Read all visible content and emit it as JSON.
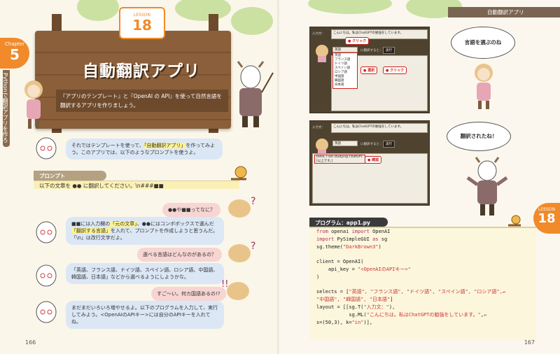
{
  "left": {
    "chapter": {
      "label": "Chapter",
      "number": "5"
    },
    "vertical_title": "Pythonで翻訳アプリを作ろう",
    "lesson": {
      "label": "LESSON",
      "number": "18"
    },
    "title": "自動翻訳アプリ",
    "subtitle": "『アプリのテンプレート』と『OpenAI の API』を使って自然言語を翻訳するアプリを作りましょう。",
    "bubble1": {
      "pre": "それではテンプレートを使って、",
      "highlight": "「自動翻訳アプリ」",
      "post": "を作ってみよう。このアプリでは、以下のようなプロンプトを使うよ。"
    },
    "prompt_label": "プロンプト",
    "prompt_text": "以下の文章を ●● に翻訳してください。\\n###■■",
    "bubble2": "●●や■■ってなに？",
    "bubble3": {
      "p1": "■■には入力欄の",
      "h1": "「元の文章」",
      "p2": "、●●にはコンボボックスで選んだ",
      "h2": "「翻訳する言語」",
      "p3": "を入れて、プロンプトを作成しようと思うんだ。「\\n」は改行文字だよ。"
    },
    "bubble4": "選べる言語はどんなのがあるの？",
    "bubble5": "「英語、フランス語、ドイツ語、スペイン語、ロシア語、中国語、韓国語、日本語」などから選べるようにしようかな。",
    "bubble6": "すご〜い。何カ国語あるの!?",
    "bubble7": "まだまだいろいろ増やせるよ。以下のプログラムを入力して、実行してみよう。<OpenAIのAPIキー>には自分のAPIキーを入れてね。",
    "page_number": "166"
  },
  "right": {
    "header": "自動翻訳アプリ",
    "shot1": {
      "label": "入力文：",
      "text": "こんにちは。私はChatGPTの勉強をしています。",
      "select_value": "英語",
      "translate_label": "に翻訳すると：",
      "run_button": "実行",
      "options": [
        "英語",
        "フランス語",
        "ドイツ語",
        "スペイン語",
        "ロシア語",
        "中国語",
        "韓国語",
        "日本語"
      ]
    },
    "callouts": {
      "click1": "クリック",
      "select": "選択",
      "click2": "クリック",
      "confirm": "確認"
    },
    "shot2": {
      "label": "入力文：",
      "text": "こんにちは。私はChatGPTの勉強をしています。",
      "select_value": "英語",
      "translate_label": "に翻訳すると：",
      "run_button": "実行",
      "result_line1": "Hello, I am studying ChatGPT.",
      "result_line2": "[以上です。]"
    },
    "cloud1": "言語を選ぶのね",
    "cloud2": "翻訳されたね！",
    "lesson": {
      "label": "LESSON",
      "number": "18"
    },
    "code_label": "プログラム：app1.py",
    "code": {
      "l1": {
        "k1": "from",
        "a": " openai ",
        "k2": "import",
        "b": " OpenAI"
      },
      "l2": {
        "k1": "import",
        "a": " PySimpleGUI ",
        "k2": "as",
        "b": " sg"
      },
      "l3": {
        "a": "sg.theme(",
        "s": "\"DarkBrown3\"",
        "b": ")"
      },
      "l5": "client = OpenAI(",
      "l6": {
        "a": "    api_key = ",
        "s": "\"<OpenAIのAPIキー>\""
      },
      "l7": ")",
      "l9": {
        "a": "selects = [",
        "s": "\"英語\", \"フランス語\", \"ドイツ語\", \"スペイン語\", \"ロシア語\",",
        "w": "↵"
      },
      "l10": {
        "s": "\"中国語\", \"韓国語\", \"日本語\"",
        "b": "]"
      },
      "l11": {
        "a": "layout = [[sg.T(",
        "s": "\"入力文：\"",
        "b": "),"
      },
      "l12": {
        "a": "           sg.ML(",
        "s": "\"こんにちは。私はChatGPTの勉強をしています。\"",
        "b": ",",
        "w": "↵"
      },
      "l13": {
        "a": "s=(50,3), k=",
        "s": "\"in\"",
        "b": ")],"
      }
    },
    "page_number": "167"
  }
}
